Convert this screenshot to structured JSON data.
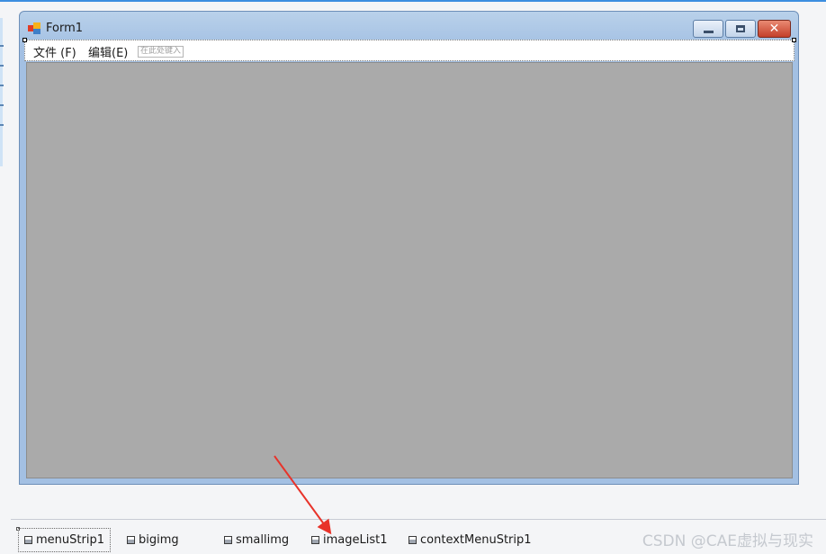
{
  "form": {
    "title": "Form1",
    "menu": [
      {
        "label": "文件 (F)"
      },
      {
        "label": "编辑(E)"
      }
    ],
    "menu_hint": "在此处键入",
    "client_color": "#aaaaaa"
  },
  "tray": {
    "components": [
      {
        "name": "menuStrip1",
        "selected": true
      },
      {
        "name": "bigimg"
      },
      {
        "name": "smallimg"
      },
      {
        "name": "imageList1"
      },
      {
        "name": "contextMenuStrip1"
      }
    ]
  },
  "watermark": "CSDN @CAE虚拟与现实",
  "annotation": {
    "arrow_color": "#e8332a"
  },
  "colors": {
    "accent": "#3c8ee0",
    "titlebar": "#a3c0e3",
    "close_button": "#c4402a"
  }
}
